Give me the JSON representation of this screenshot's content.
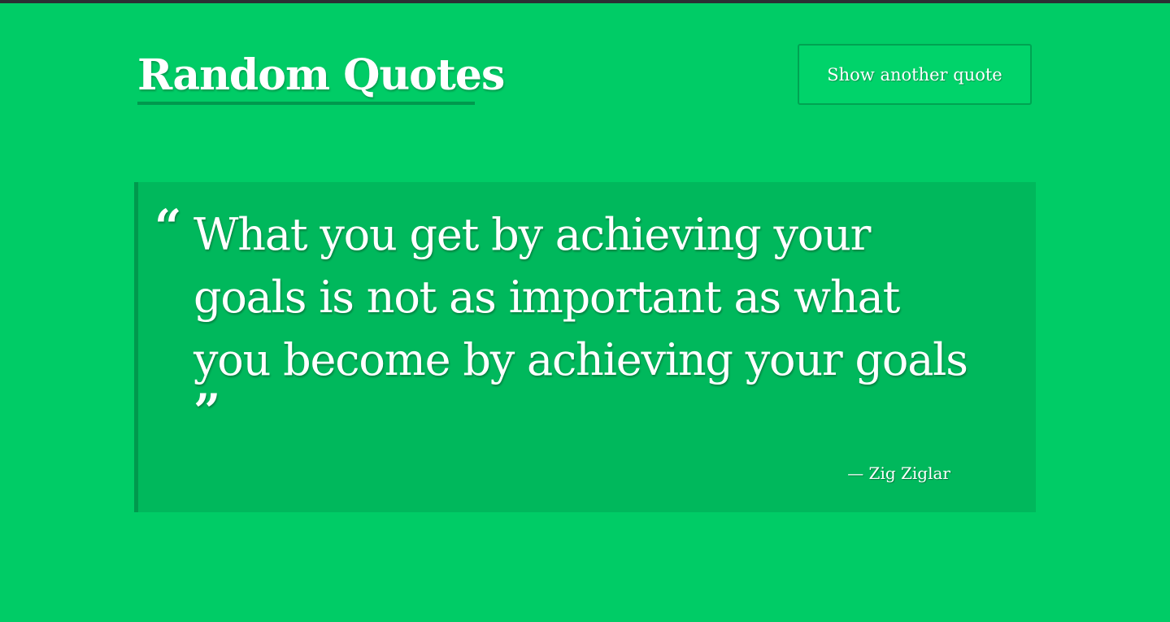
{
  "header": {
    "title": "Random Quotes",
    "button_label": "Show another quote"
  },
  "quote": {
    "open_mark": "“",
    "text": "What you get by achieving your goals is not as important as what you become by achieving your goals",
    "close_mark": "”",
    "author": "— Zig Ziglar"
  },
  "colors": {
    "background": "#00cc66",
    "card": "#00b85c",
    "accent": "#00994d",
    "text": "#ffffff"
  }
}
